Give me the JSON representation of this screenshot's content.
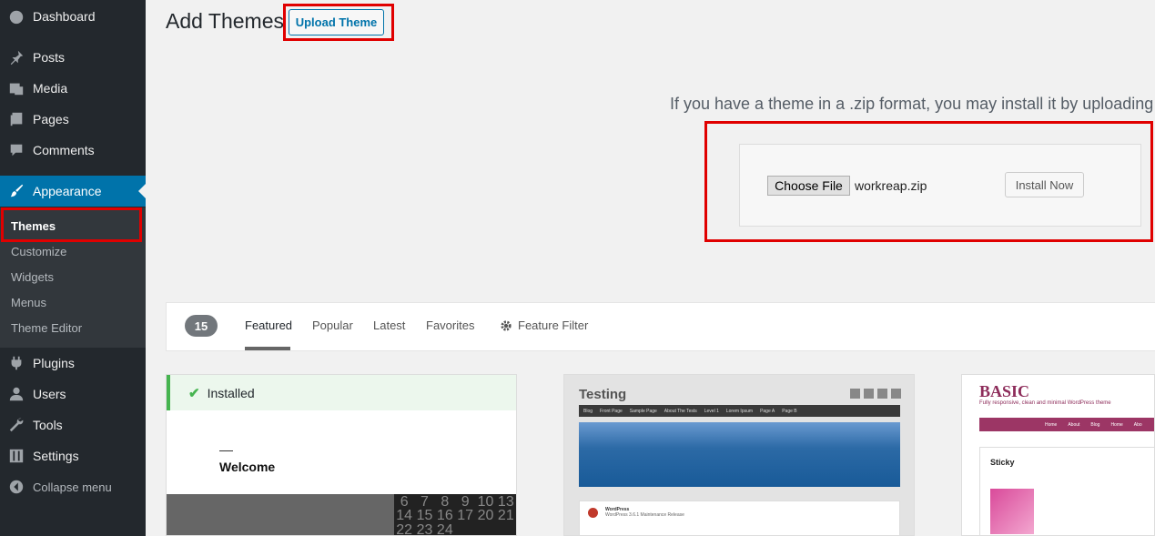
{
  "sidebar": {
    "menu": [
      {
        "label": "Dashboard",
        "icon": "dashboard-icon"
      },
      {
        "label": "Posts",
        "icon": "pin-icon"
      },
      {
        "label": "Media",
        "icon": "media-icon"
      },
      {
        "label": "Pages",
        "icon": "pages-icon"
      },
      {
        "label": "Comments",
        "icon": "comment-icon"
      },
      {
        "label": "Appearance",
        "icon": "brush-icon"
      },
      {
        "label": "Plugins",
        "icon": "plugin-icon"
      },
      {
        "label": "Users",
        "icon": "user-icon"
      },
      {
        "label": "Tools",
        "icon": "wrench-icon"
      },
      {
        "label": "Settings",
        "icon": "settings-icon"
      },
      {
        "label": "Collapse menu",
        "icon": "collapse-icon"
      }
    ],
    "submenu": [
      "Themes",
      "Customize",
      "Widgets",
      "Menus",
      "Theme Editor"
    ],
    "accent": "#0073aa"
  },
  "header": {
    "title": "Add Themes",
    "upload_button": "Upload Theme"
  },
  "upload": {
    "description": "If you have a theme in a .zip format, you may install it by uploading",
    "choose_file": "Choose File",
    "file_name": "workreap.zip",
    "install_button": "Install Now"
  },
  "filters": {
    "count": "15",
    "links": [
      "Featured",
      "Popular",
      "Latest",
      "Favorites"
    ],
    "feature_filter": "Feature Filter"
  },
  "cards": {
    "installed": {
      "status": "Installed",
      "preview_heading": "Welcome",
      "calendar": [
        "6",
        "7",
        "8",
        "9",
        "10",
        "13",
        "14",
        "15",
        "16",
        "17",
        "20",
        "21",
        "22",
        "23",
        "24"
      ]
    },
    "testing": {
      "title": "Testing",
      "nav": [
        "Blog",
        "Front Page",
        "Sample Page",
        "About The Tests",
        "Level 1",
        "Lorem Ipsum",
        "Page A",
        "Page B"
      ],
      "tweet_author": "WordPress",
      "tweet_text": "WordPress 3.6.1 Maintenance Release"
    },
    "basic": {
      "title": "BASIC",
      "tagline": "Fully responsive, clean and minimal WordPress theme",
      "nav": [
        "Home",
        "About",
        "Blog",
        "Home",
        "Abo"
      ],
      "post_title": "Sticky"
    }
  },
  "highlight_color": "#e00000"
}
